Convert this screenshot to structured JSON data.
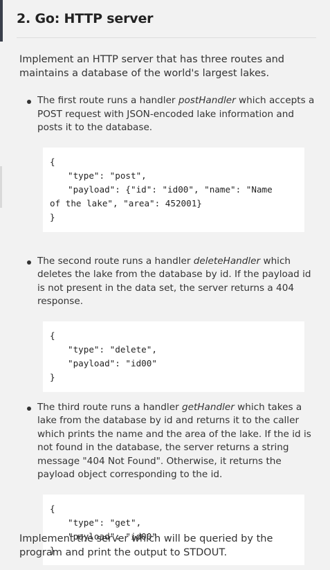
{
  "title": "2. Go: HTTP server",
  "intro": "Implement an HTTP server that has three routes and maintains a database of the world's largest lakes.",
  "routes": [
    {
      "pre": "The first route runs a handler ",
      "handler": "postHandler",
      "post": " which accepts a POST request with JSON-encoded lake information and posts it to the database.",
      "code": {
        "open": "{",
        "line1": "\"type\": \"post\",",
        "line2": "\"payload\": {\"id\": \"id00\", \"name\": \"Name",
        "line3": "of the lake\", \"area\": 452001}",
        "close": "}"
      }
    },
    {
      "pre": "The second route runs a handler ",
      "handler": "deleteHandler",
      "post": " which deletes the lake from the database by id. If the payload id is not present in the data set, the server returns a 404 response.",
      "code": {
        "open": "{",
        "line1": "\"type\": \"delete\",",
        "line2": "\"payload\": \"id00\"",
        "close": "}"
      }
    },
    {
      "pre": "The third route runs a handler ",
      "handler": "getHandler",
      "post": " which takes a lake from the database by id and returns it to the caller which prints the name and the area of the lake. If the id is not found in the database, the server returns a string message \"404 Not Found\". Otherwise, it returns the payload object corresponding to the id.",
      "code": {
        "open": "{",
        "line1": "\"type\": \"get\",",
        "line2": "\"payload\": \"id00\"",
        "close": "}"
      }
    }
  ],
  "outro": "Implement the server which will be queried by the program and print the output to STDOUT."
}
